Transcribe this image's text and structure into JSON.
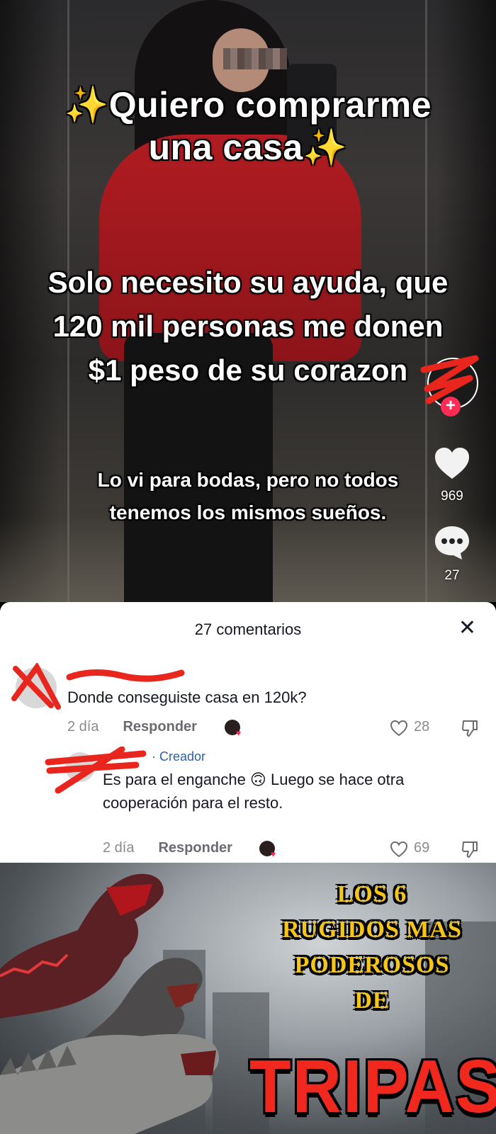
{
  "video": {
    "caption_line1": "✨Quiero comprarme",
    "caption_line2": "una casa✨",
    "caption_middle_1": "Solo necesito su ayuda, que",
    "caption_middle_2": "120 mil personas me donen",
    "caption_middle_3": "$1 peso de su corazon",
    "caption_bottom_1": "Lo vi para bodas, pero no todos",
    "caption_bottom_2": "tenemos los mismos sueños.",
    "likes": "969",
    "comments": "27"
  },
  "comments_sheet": {
    "title": "27 comentarios",
    "close": "✕",
    "items": [
      {
        "text": "Donde conseguiste casa en 120k?",
        "time": "2 día",
        "reply": "Responder",
        "likes": "28"
      },
      {
        "creator_tag": "· Creador",
        "text_1": "Es para el enganche 🙃 Luego se hace otra",
        "text_2": "cooperación para el resto.",
        "time": "2 día",
        "reply": "Responder",
        "likes": "69"
      }
    ]
  },
  "banner": {
    "title_1": "LOS 6",
    "title_2": "RUGIDOS MAS",
    "title_3": "PODEROSOS",
    "title_4": "DE",
    "big": "TRIPAS"
  },
  "colors": {
    "accent": "#ff2d55",
    "creator": "#2b5fa8",
    "banner_yellow": "#f5c518",
    "banner_red": "#f0281e"
  }
}
